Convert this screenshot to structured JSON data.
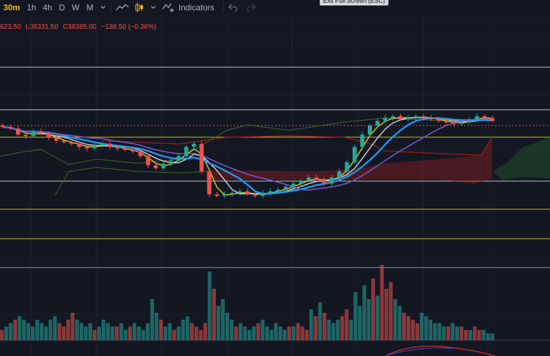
{
  "toolbar": {
    "intervals": [
      "30m",
      "1h",
      "4h",
      "D",
      "W",
      "M"
    ],
    "active_interval": "30m",
    "indicators_label": "Indicators",
    "tooltip": "Exit Full Screen (ESC)",
    "icons": [
      "chevron-down-icon",
      "line-chart-icon",
      "candle-icon",
      "chevron-down-icon",
      "indicators-icon",
      "undo-icon",
      "redo-icon"
    ]
  },
  "ohlc": {
    "high": "623.50",
    "low": "L38331.50",
    "close": "C38385.00",
    "change": "−138.50 (−0.36%)"
  },
  "colors": {
    "background": "#131722",
    "up": "#26a69a",
    "down": "#ef5350",
    "accent": "#f0b90b"
  },
  "chart_data": {
    "type": "candlestick",
    "interval": "30m",
    "price_ohlc_last": {
      "low": 38331.5,
      "close": 38385.0,
      "change": -138.5,
      "change_pct": -0.36
    },
    "horizontal_levels": [
      {
        "color": "white",
        "level": 1
      },
      {
        "color": "white",
        "level": 2
      },
      {
        "color": "yellow",
        "level": 3
      },
      {
        "color": "white",
        "level": 4
      },
      {
        "color": "yellow",
        "level": 5
      },
      {
        "color": "yellow",
        "level": 6
      }
    ],
    "close_series": [
      38750,
      38740,
      38700,
      38690,
      38720,
      38710,
      38680,
      38660,
      38650,
      38640,
      38620,
      38610,
      38630,
      38640,
      38620,
      38610,
      38600,
      38590,
      38560,
      38500,
      38480,
      38510,
      38530,
      38560,
      38620,
      38640,
      38460,
      38310,
      38300,
      38310,
      38320,
      38330,
      38310,
      38300,
      38320,
      38330,
      38340,
      38360,
      38380,
      38400,
      38420,
      38410,
      38380,
      38420,
      38460,
      38520,
      38620,
      38700,
      38760,
      38790,
      38810,
      38820,
      38800,
      38810,
      38820,
      38810,
      38800,
      38790,
      38780,
      38770,
      38780,
      38800,
      38820,
      38810,
      38790
    ],
    "volume_series": [
      3,
      4,
      5,
      6,
      7,
      6,
      5,
      4,
      6,
      5,
      4,
      6,
      7,
      5,
      4,
      6,
      8,
      6,
      5,
      4,
      5,
      3,
      4,
      6,
      5,
      4,
      4,
      5,
      3,
      4,
      5,
      4,
      3,
      5,
      12,
      8,
      6,
      4,
      5,
      3,
      4,
      6,
      7,
      5,
      4,
      3,
      5,
      20,
      15,
      10,
      12,
      8,
      6,
      4,
      5,
      4,
      3,
      4,
      5,
      6,
      4,
      3,
      5,
      4,
      3,
      4,
      4,
      5,
      4,
      3,
      9,
      7,
      11,
      8,
      6,
      5,
      6,
      7,
      9,
      6,
      14,
      10,
      16,
      12,
      18,
      13,
      22,
      15,
      17,
      12,
      10,
      8,
      7,
      6,
      5,
      8,
      7,
      6,
      5,
      5,
      4,
      4,
      5,
      4,
      4,
      3,
      3,
      4,
      3,
      3,
      2,
      2
    ]
  }
}
